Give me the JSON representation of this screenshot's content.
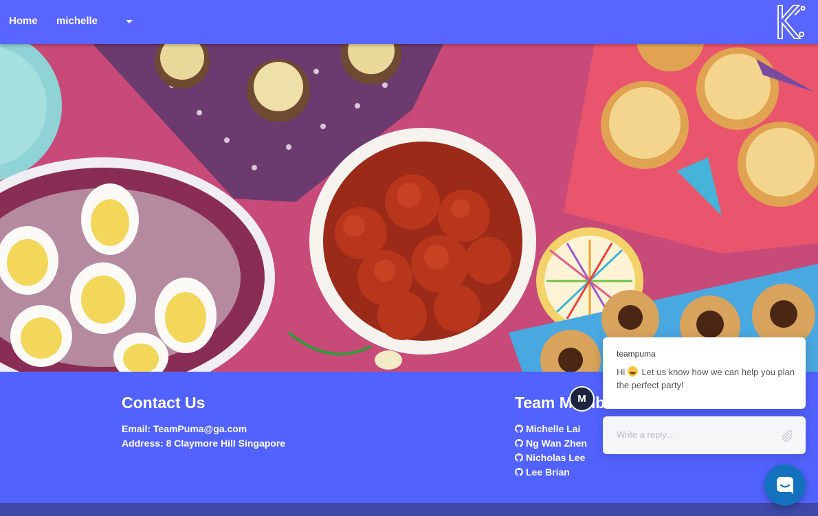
{
  "nav": {
    "home_label": "Home",
    "user_label": "michelle",
    "logo_icon": "k-logo-icon"
  },
  "hero": {
    "image": "party-food-photo"
  },
  "contact": {
    "title": "Contact Us",
    "email": "Email: TeamPuma@ga.com",
    "address": "Address: 8 Claymore Hill Singapore"
  },
  "team": {
    "title": "Team Members",
    "members": [
      "Michelle Lai",
      "Ng Wan Zhen",
      "Nicholas Lee",
      "Lee Brian"
    ],
    "member_icon": "github-icon"
  },
  "chat": {
    "author": "teampuma",
    "message_prefix": "Hi",
    "message": "Let us know how we can help you plan the perfect party!",
    "avatar_initial": "M",
    "reply_placeholder": "Write a reply…"
  },
  "colors": {
    "primary": "#5262ff",
    "navbar": "#5866ff",
    "footer_bottom": "#3e48a8",
    "launcher": "#1371bd",
    "avatar": "#1d2440"
  }
}
